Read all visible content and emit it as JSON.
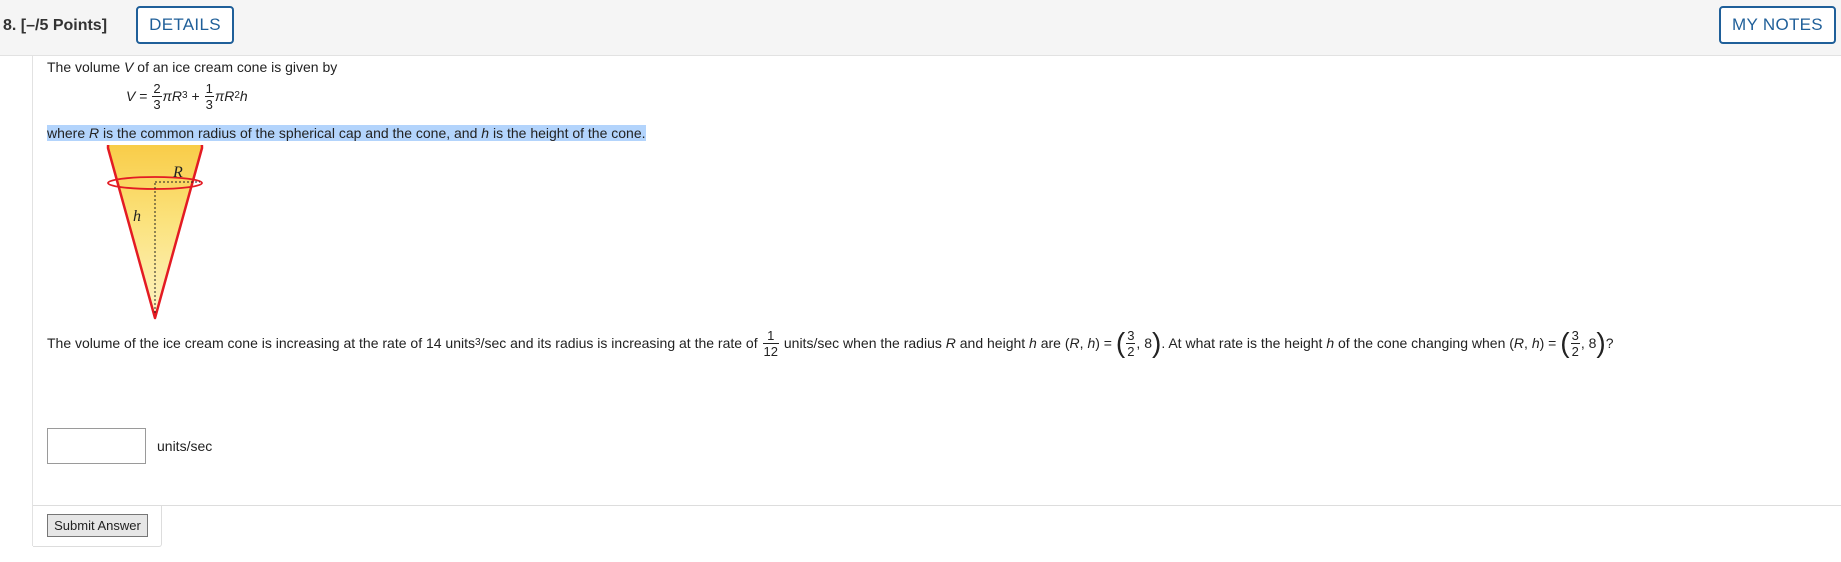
{
  "header": {
    "question_number": "8.",
    "points": "[–/5 Points]",
    "details_label": "DETAILS",
    "my_notes_label": "MY NOTES"
  },
  "problem": {
    "intro_pre": "The volume ",
    "intro_var": "V",
    "intro_post": " of an ice cream cone is given by",
    "formula": {
      "lhs": "V",
      "eq": " = ",
      "frac1_num": "2",
      "frac1_den": "3",
      "term1": "πR",
      "term1_exp": "3",
      "plus": " + ",
      "frac2_num": "1",
      "frac2_den": "3",
      "term2": "πR",
      "term2_exp": "2",
      "term2_tail": "h"
    },
    "where": {
      "p1": "where ",
      "R": "R",
      "p2": " is the common radius of the spherical cap and the cone, and ",
      "h": "h",
      "p3": " is the height of the cone."
    },
    "figure": {
      "label_R": "R",
      "label_h": "h",
      "fill_top": "#f7c02a",
      "fill_bottom": "#fdf3c4",
      "outline": "#e31b23"
    },
    "rate": {
      "s1": "The volume of the ice cream cone is increasing at the rate of 14 units",
      "s1_exp": "3",
      "s2": "/sec and its radius is increasing at the rate of ",
      "f1_num": "1",
      "f1_den": "12",
      "s3": " units/sec when the radius ",
      "R": "R",
      "s4": " and height ",
      "h": "h",
      "s5": " are (",
      "R2": "R",
      "s6": ", ",
      "h2": "h",
      "s7": ") = ",
      "paren_open": "(",
      "f2_num": "3",
      "f2_den": "2",
      "s8": ", 8",
      "paren_close": ")",
      "s9": ". At what rate is the height ",
      "h3": "h",
      "s10": " of the cone changing when (",
      "R3": "R",
      "s11": ", ",
      "h4": "h",
      "s12": ") = ",
      "paren_open2": "(",
      "f3_num": "3",
      "f3_den": "2",
      "s13": ", 8",
      "paren_close2": ")",
      "s14": "?"
    },
    "answer": {
      "value": "",
      "units": "units/sec"
    },
    "submit_label": "Submit Answer"
  }
}
